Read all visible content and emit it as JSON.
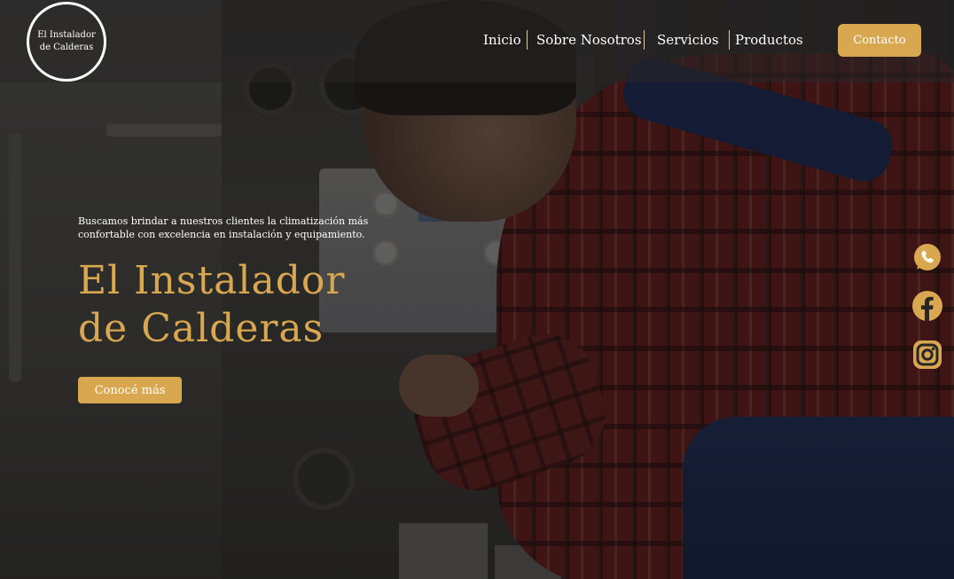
{
  "brand": {
    "logo_line1": "El Instalador",
    "logo_line2": "de Calderas"
  },
  "nav": {
    "items": [
      {
        "label": "Inicio"
      },
      {
        "label": "Sobre Nosotros"
      },
      {
        "label": "Servicios"
      },
      {
        "label": "Productos"
      }
    ],
    "contact_label": "Contacto"
  },
  "hero": {
    "tagline_line1": "Buscamos brindar a nuestros clientes la climatización más",
    "tagline_line2": "confortable con excelencia en instalación y equipamiento.",
    "title_line1": "El Instalador",
    "title_line2": "de Calderas",
    "cta_label": "Conocé más"
  },
  "social": [
    "whatsapp-icon",
    "facebook-icon",
    "instagram-icon"
  ],
  "colors": {
    "accent": "#d9a74f",
    "text": "#ffffff",
    "header_bg": "#282726"
  }
}
